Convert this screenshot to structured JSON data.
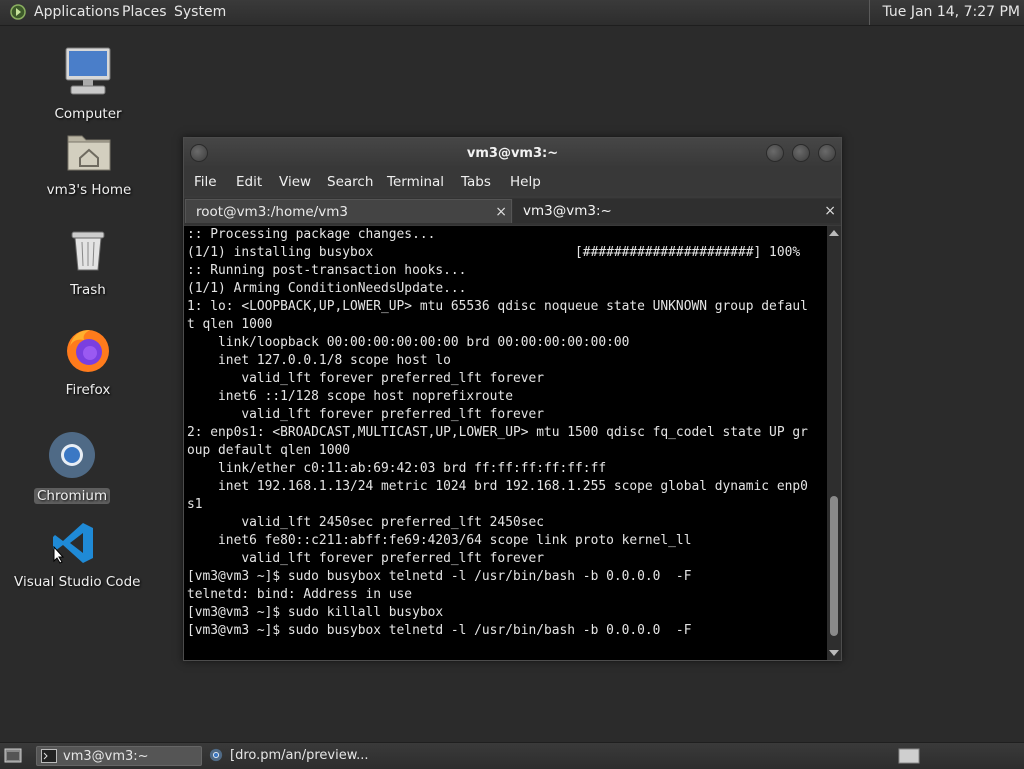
{
  "top_panel": {
    "menus": [
      "Applications",
      "Places",
      "System"
    ],
    "clock": "Tue Jan 14,  7:27 PM"
  },
  "desktop_icons": [
    {
      "label": "Computer",
      "icon": "computer-icon"
    },
    {
      "label": "vm3's Home",
      "icon": "home-folder-icon"
    },
    {
      "label": "Trash",
      "icon": "trash-icon"
    },
    {
      "label": "Firefox",
      "icon": "firefox-icon"
    },
    {
      "label": "Chromium",
      "icon": "chromium-icon"
    },
    {
      "label": "Visual Studio Code",
      "icon": "vscode-icon"
    }
  ],
  "terminal_window": {
    "title": "vm3@vm3:~",
    "menu": [
      "File",
      "Edit",
      "View",
      "Search",
      "Terminal",
      "Tabs",
      "Help"
    ],
    "tabs": [
      {
        "label": "root@vm3:/home/vm3",
        "close": "×"
      },
      {
        "label": "vm3@vm3:~",
        "close": "×"
      }
    ],
    "lines": [
      ":: Processing package changes...",
      "(1/1) installing busybox                          [######################] 100%",
      ":: Running post-transaction hooks...",
      "(1/1) Arming ConditionNeedsUpdate...",
      "1: lo: <LOOPBACK,UP,LOWER_UP> mtu 65536 qdisc noqueue state UNKNOWN group defaul",
      "t qlen 1000",
      "    link/loopback 00:00:00:00:00:00 brd 00:00:00:00:00:00",
      "    inet 127.0.0.1/8 scope host lo",
      "       valid_lft forever preferred_lft forever",
      "    inet6 ::1/128 scope host noprefixroute",
      "       valid_lft forever preferred_lft forever",
      "2: enp0s1: <BROADCAST,MULTICAST,UP,LOWER_UP> mtu 1500 qdisc fq_codel state UP gr",
      "oup default qlen 1000",
      "    link/ether c0:11:ab:69:42:03 brd ff:ff:ff:ff:ff:ff",
      "    inet 192.168.1.13/24 metric 1024 brd 192.168.1.255 scope global dynamic enp0",
      "s1",
      "       valid_lft 2450sec preferred_lft 2450sec",
      "    inet6 fe80::c211:abff:fe69:4203/64 scope link proto kernel_ll",
      "       valid_lft forever preferred_lft forever",
      "[vm3@vm3 ~]$ sudo busybox telnetd -l /usr/bin/bash -b 0.0.0.0  -F",
      "telnetd: bind: Address in use",
      "[vm3@vm3 ~]$ sudo killall busybox",
      "[vm3@vm3 ~]$ sudo busybox telnetd -l /usr/bin/bash -b 0.0.0.0  -F"
    ]
  },
  "bottom_panel": {
    "tasks": [
      {
        "label": "vm3@vm3:~",
        "icon": "terminal-icon",
        "active": true
      },
      {
        "label": "[dro.pm/an/preview...",
        "icon": "chromium-icon",
        "active": false
      }
    ]
  }
}
